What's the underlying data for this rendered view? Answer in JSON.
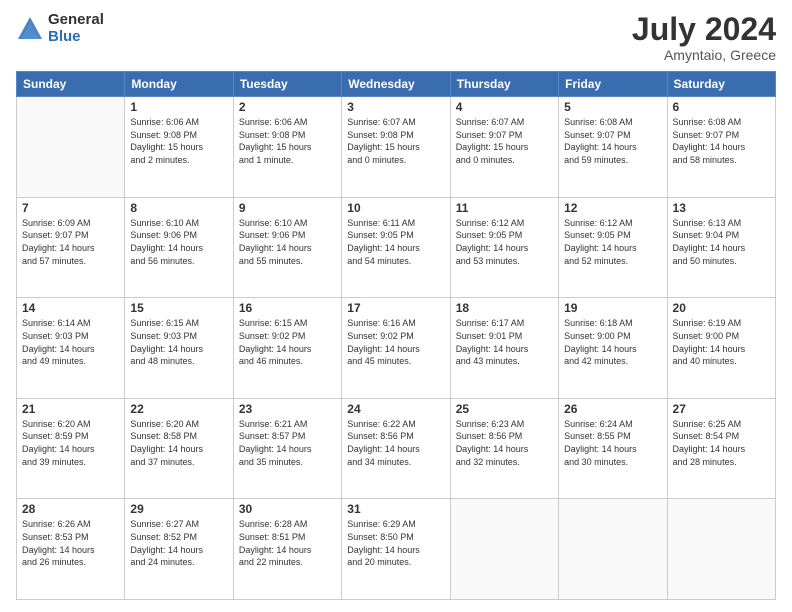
{
  "header": {
    "logo_general": "General",
    "logo_blue": "Blue",
    "month": "July 2024",
    "location": "Amyntaio, Greece"
  },
  "days_of_week": [
    "Sunday",
    "Monday",
    "Tuesday",
    "Wednesday",
    "Thursday",
    "Friday",
    "Saturday"
  ],
  "weeks": [
    [
      {
        "day": "",
        "info": ""
      },
      {
        "day": "1",
        "info": "Sunrise: 6:06 AM\nSunset: 9:08 PM\nDaylight: 15 hours\nand 2 minutes."
      },
      {
        "day": "2",
        "info": "Sunrise: 6:06 AM\nSunset: 9:08 PM\nDaylight: 15 hours\nand 1 minute."
      },
      {
        "day": "3",
        "info": "Sunrise: 6:07 AM\nSunset: 9:08 PM\nDaylight: 15 hours\nand 0 minutes."
      },
      {
        "day": "4",
        "info": "Sunrise: 6:07 AM\nSunset: 9:07 PM\nDaylight: 15 hours\nand 0 minutes."
      },
      {
        "day": "5",
        "info": "Sunrise: 6:08 AM\nSunset: 9:07 PM\nDaylight: 14 hours\nand 59 minutes."
      },
      {
        "day": "6",
        "info": "Sunrise: 6:08 AM\nSunset: 9:07 PM\nDaylight: 14 hours\nand 58 minutes."
      }
    ],
    [
      {
        "day": "7",
        "info": "Sunrise: 6:09 AM\nSunset: 9:07 PM\nDaylight: 14 hours\nand 57 minutes."
      },
      {
        "day": "8",
        "info": "Sunrise: 6:10 AM\nSunset: 9:06 PM\nDaylight: 14 hours\nand 56 minutes."
      },
      {
        "day": "9",
        "info": "Sunrise: 6:10 AM\nSunset: 9:06 PM\nDaylight: 14 hours\nand 55 minutes."
      },
      {
        "day": "10",
        "info": "Sunrise: 6:11 AM\nSunset: 9:05 PM\nDaylight: 14 hours\nand 54 minutes."
      },
      {
        "day": "11",
        "info": "Sunrise: 6:12 AM\nSunset: 9:05 PM\nDaylight: 14 hours\nand 53 minutes."
      },
      {
        "day": "12",
        "info": "Sunrise: 6:12 AM\nSunset: 9:05 PM\nDaylight: 14 hours\nand 52 minutes."
      },
      {
        "day": "13",
        "info": "Sunrise: 6:13 AM\nSunset: 9:04 PM\nDaylight: 14 hours\nand 50 minutes."
      }
    ],
    [
      {
        "day": "14",
        "info": "Sunrise: 6:14 AM\nSunset: 9:03 PM\nDaylight: 14 hours\nand 49 minutes."
      },
      {
        "day": "15",
        "info": "Sunrise: 6:15 AM\nSunset: 9:03 PM\nDaylight: 14 hours\nand 48 minutes."
      },
      {
        "day": "16",
        "info": "Sunrise: 6:15 AM\nSunset: 9:02 PM\nDaylight: 14 hours\nand 46 minutes."
      },
      {
        "day": "17",
        "info": "Sunrise: 6:16 AM\nSunset: 9:02 PM\nDaylight: 14 hours\nand 45 minutes."
      },
      {
        "day": "18",
        "info": "Sunrise: 6:17 AM\nSunset: 9:01 PM\nDaylight: 14 hours\nand 43 minutes."
      },
      {
        "day": "19",
        "info": "Sunrise: 6:18 AM\nSunset: 9:00 PM\nDaylight: 14 hours\nand 42 minutes."
      },
      {
        "day": "20",
        "info": "Sunrise: 6:19 AM\nSunset: 9:00 PM\nDaylight: 14 hours\nand 40 minutes."
      }
    ],
    [
      {
        "day": "21",
        "info": "Sunrise: 6:20 AM\nSunset: 8:59 PM\nDaylight: 14 hours\nand 39 minutes."
      },
      {
        "day": "22",
        "info": "Sunrise: 6:20 AM\nSunset: 8:58 PM\nDaylight: 14 hours\nand 37 minutes."
      },
      {
        "day": "23",
        "info": "Sunrise: 6:21 AM\nSunset: 8:57 PM\nDaylight: 14 hours\nand 35 minutes."
      },
      {
        "day": "24",
        "info": "Sunrise: 6:22 AM\nSunset: 8:56 PM\nDaylight: 14 hours\nand 34 minutes."
      },
      {
        "day": "25",
        "info": "Sunrise: 6:23 AM\nSunset: 8:56 PM\nDaylight: 14 hours\nand 32 minutes."
      },
      {
        "day": "26",
        "info": "Sunrise: 6:24 AM\nSunset: 8:55 PM\nDaylight: 14 hours\nand 30 minutes."
      },
      {
        "day": "27",
        "info": "Sunrise: 6:25 AM\nSunset: 8:54 PM\nDaylight: 14 hours\nand 28 minutes."
      }
    ],
    [
      {
        "day": "28",
        "info": "Sunrise: 6:26 AM\nSunset: 8:53 PM\nDaylight: 14 hours\nand 26 minutes."
      },
      {
        "day": "29",
        "info": "Sunrise: 6:27 AM\nSunset: 8:52 PM\nDaylight: 14 hours\nand 24 minutes."
      },
      {
        "day": "30",
        "info": "Sunrise: 6:28 AM\nSunset: 8:51 PM\nDaylight: 14 hours\nand 22 minutes."
      },
      {
        "day": "31",
        "info": "Sunrise: 6:29 AM\nSunset: 8:50 PM\nDaylight: 14 hours\nand 20 minutes."
      },
      {
        "day": "",
        "info": ""
      },
      {
        "day": "",
        "info": ""
      },
      {
        "day": "",
        "info": ""
      }
    ]
  ]
}
